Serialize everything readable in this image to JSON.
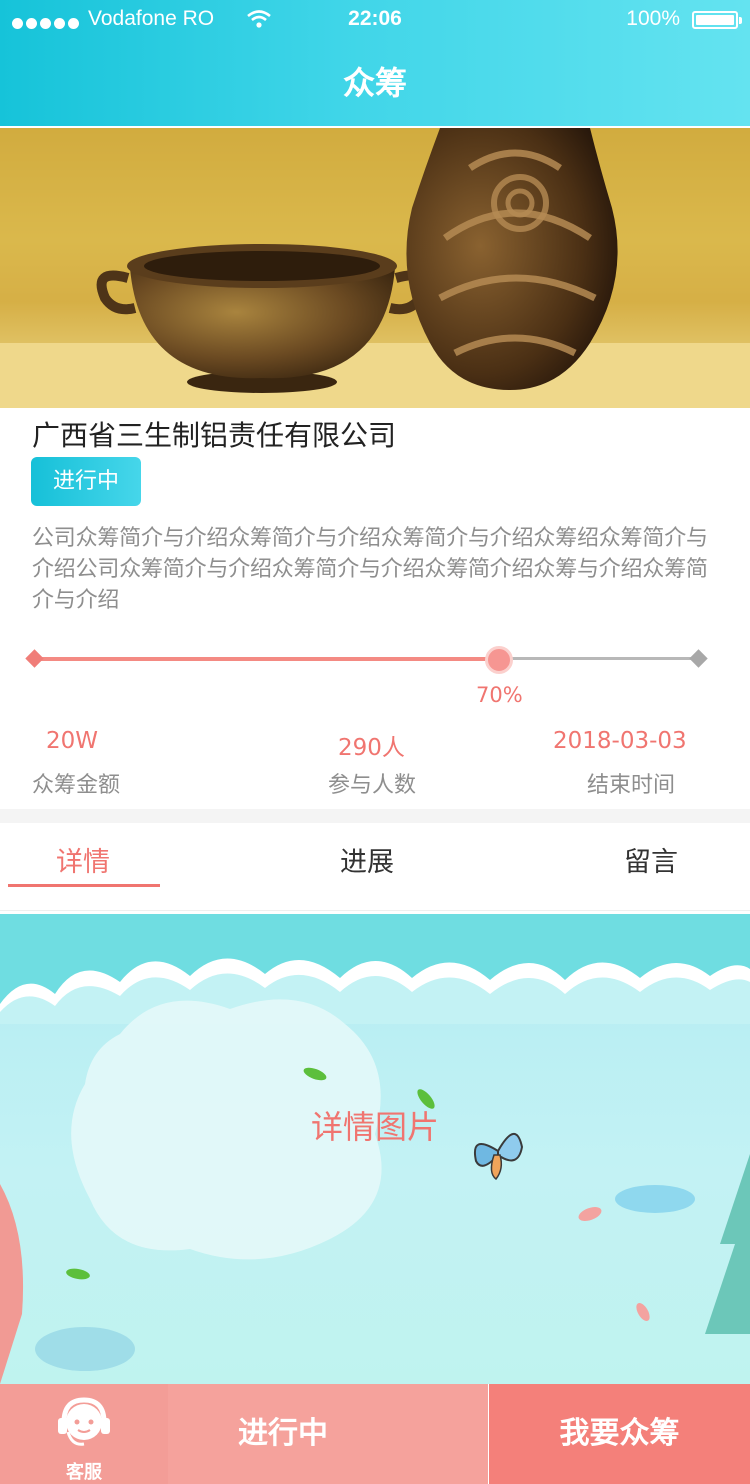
{
  "status_bar": {
    "carrier": "Vodafone RO",
    "time": "22:06",
    "battery": "100%"
  },
  "nav": {
    "title": "众筹"
  },
  "project": {
    "company": "广西省三生制铝责任有限公司",
    "status": "进行中",
    "intro": "公司众筹简介与介绍众筹简介与介绍众筹简介与介绍众筹绍众筹简介与介绍公司众筹简介与介绍众筹简介与介绍众筹简介绍众筹与介绍众筹简介与介绍"
  },
  "progress": {
    "value": 0.7,
    "label": "70%"
  },
  "stats": [
    {
      "value": "20W",
      "label": "众筹金额"
    },
    {
      "value": "290人",
      "label": "参与人数"
    },
    {
      "value": "2018-03-03",
      "label": "结束时间"
    }
  ],
  "tabs": [
    {
      "label": "详情",
      "active": true
    },
    {
      "label": "进展",
      "active": false
    },
    {
      "label": "留言",
      "active": false
    }
  ],
  "detail": {
    "placeholder": "详情图片"
  },
  "bottom_bar": {
    "service_label": "客服",
    "status_label": "进行中",
    "action_label": "我要众筹"
  },
  "colors": {
    "accent": "#f07570",
    "header_teal": "#16c3d9",
    "button_pink": "#f5a29c",
    "button_coral": "#f4807a"
  }
}
